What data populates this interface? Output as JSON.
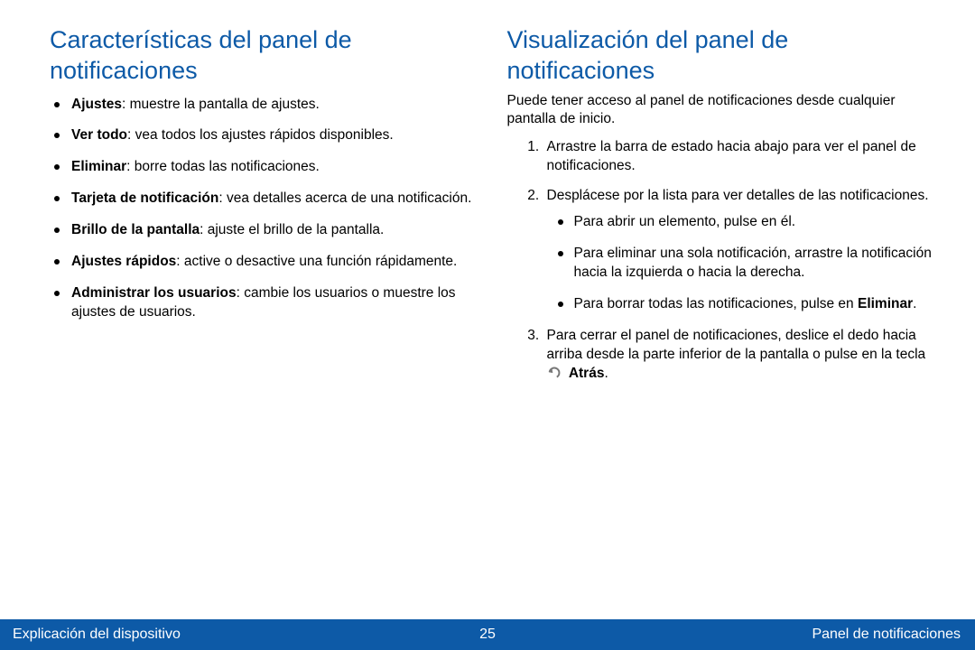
{
  "left": {
    "title": "Características del panel de notificaciones",
    "items": [
      {
        "bold": "Ajustes",
        "rest": ": muestre la pantalla de ajustes."
      },
      {
        "bold": "Ver todo",
        "rest": ": vea todos los ajustes rápidos disponibles."
      },
      {
        "bold": "Eliminar",
        "rest": ": borre todas las notificaciones."
      },
      {
        "bold": "Tarjeta de notificación",
        "rest": ": vea detalles acerca de una notificación."
      },
      {
        "bold": "Brillo de la pantalla",
        "rest": ": ajuste el brillo de la pantalla."
      },
      {
        "bold": "Ajustes rápidos",
        "rest": ": active o desactive una función rápidamente."
      },
      {
        "bold": "Administrar los usuarios",
        "rest": ": cambie los usuarios o muestre los ajustes de usuarios."
      }
    ]
  },
  "right": {
    "title": "Visualización del panel de notificaciones",
    "intro": "Puede tener acceso al panel de notificaciones desde cualquier pantalla de inicio.",
    "step1": "Arrastre la barra de estado hacia abajo para ver el panel de notificaciones.",
    "step2": "Desplácese por la lista para ver detalles de las notificaciones.",
    "sub1": "Para abrir un elemento, pulse en él.",
    "sub2": "Para eliminar una sola notificación, arrastre la notificación hacia la izquierda o hacia la derecha.",
    "sub3a": "Para borrar todas las notificaciones, pulse en ",
    "sub3b": "Eliminar",
    "sub3c": ".",
    "step3a": "Para cerrar el panel de notificaciones, deslice el dedo hacia arriba desde la parte inferior de la pantalla o pulse en la tecla ",
    "step3b": "Atrás",
    "step3c": "."
  },
  "footer": {
    "left": "Explicación del dispositivo",
    "page": "25",
    "right": "Panel de notificaciones"
  }
}
